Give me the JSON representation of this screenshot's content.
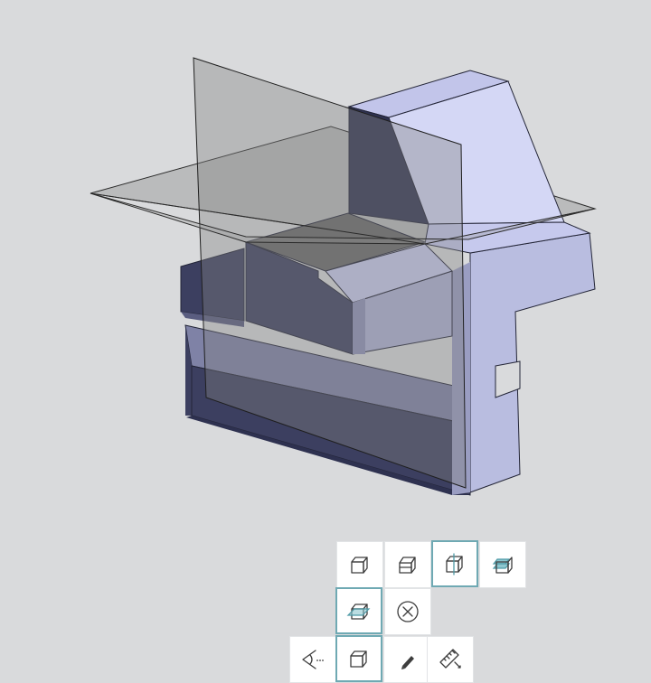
{
  "viewport": {
    "background": "#d9dadc",
    "model": {
      "face_dark": "#3c3f60",
      "face_mid": "#7f82a6",
      "face_light": "#b9bde0",
      "face_lightest": "#d4d7f5",
      "inner_cut": "#666666",
      "section_plane_fill": "rgba(138,138,138,0.45)",
      "outline": "#232537"
    }
  },
  "section_toolbar": {
    "accent_color": "#6fa9b3",
    "row1": [
      {
        "icon": "front-plane-icon",
        "active": false
      },
      {
        "icon": "top-plane-icon",
        "active": false
      },
      {
        "icon": "right-plane-icon",
        "active": true
      },
      {
        "icon": "multi-plane-icon",
        "active": false
      }
    ],
    "row2": [
      {
        "icon": "section-plane-icon",
        "active": true
      },
      {
        "icon": "close-icon",
        "active": false
      }
    ],
    "row3": [
      {
        "icon": "view-orientation-icon",
        "active": false
      },
      {
        "icon": "display-style-icon",
        "active": true
      },
      {
        "icon": "edit-pencil-icon",
        "active": false
      },
      {
        "icon": "measure-ruler-icon",
        "active": false
      }
    ]
  }
}
